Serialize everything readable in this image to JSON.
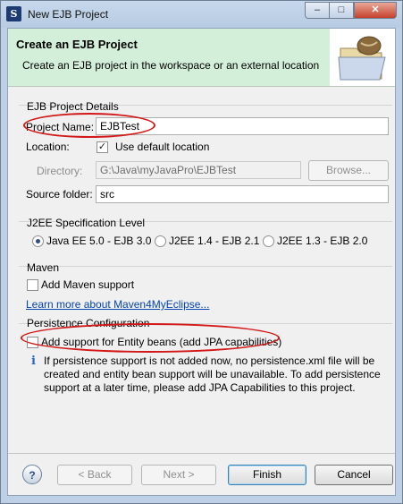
{
  "window": {
    "title": "New EJB Project",
    "min_glyph": "–",
    "max_glyph": "□",
    "close_glyph": "✕"
  },
  "banner": {
    "title": "Create an EJB Project",
    "description": "Create an EJB project in the workspace or an external location",
    "image_icon": "folder-with-bean-icon"
  },
  "details": {
    "group_label": "EJB Project Details",
    "project_name_label": "Project Name:",
    "project_name_value": "EJBTest",
    "location_label": "Location:",
    "use_default_label": "Use default location",
    "use_default_checked": true,
    "directory_label": "Directory:",
    "directory_value": "G:\\Java\\myJavaPro\\EJBTest",
    "browse_label": "Browse...",
    "source_folder_label": "Source folder:",
    "source_folder_value": "src"
  },
  "j2ee": {
    "group_label": "J2EE Specification Level",
    "options": [
      {
        "label": "Java EE 5.0 - EJB 3.0",
        "selected": true
      },
      {
        "label": "J2EE 1.4 - EJB 2.1",
        "selected": false
      },
      {
        "label": "J2EE 1.3 - EJB 2.0",
        "selected": false
      }
    ]
  },
  "maven": {
    "group_label": "Maven",
    "add_support_label": "Add Maven support",
    "add_support_checked": false,
    "learn_more_link": "Learn more about Maven4MyEclipse..."
  },
  "persistence": {
    "group_label": "Persistence Configuration",
    "add_support_label": "Add support for Entity beans (add JPA capabilities)",
    "add_support_checked": false,
    "info_glyph": "i",
    "info_lines": [
      "If persistence support is not added now, no persistence.xml file will be",
      "created and entity bean support will be unavailable. To add persistence",
      "support at a later time, please add JPA Capabilities to this project."
    ]
  },
  "footer": {
    "help_glyph": "?",
    "back_label": "< Back",
    "next_label": "Next >",
    "finish_label": "Finish",
    "cancel_label": "Cancel"
  },
  "colors": {
    "banner_bg": "#d3efd9",
    "annotation_ring": "#d21818",
    "link": "#0645ad"
  }
}
